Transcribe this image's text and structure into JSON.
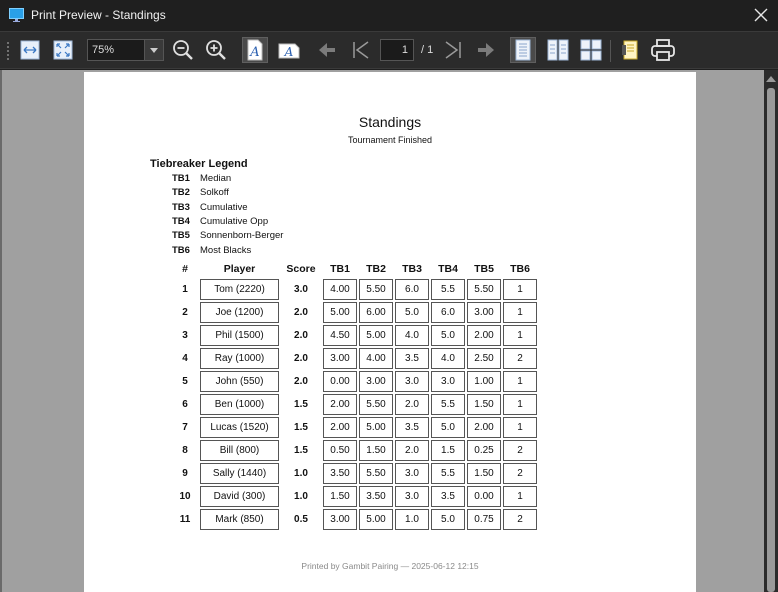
{
  "window": {
    "title": "Print Preview - Standings"
  },
  "toolbar": {
    "zoom_value": "75%",
    "current_page": "1",
    "page_count_label": "/ 1"
  },
  "document": {
    "title": "Standings",
    "subtitle": "Tournament Finished",
    "legend_heading": "Tiebreaker Legend",
    "legend": [
      {
        "code": "TB1",
        "label": "Median"
      },
      {
        "code": "TB2",
        "label": "Solkoff"
      },
      {
        "code": "TB3",
        "label": "Cumulative"
      },
      {
        "code": "TB4",
        "label": "Cumulative Opp"
      },
      {
        "code": "TB5",
        "label": "Sonnenborn-Berger"
      },
      {
        "code": "TB6",
        "label": "Most Blacks"
      }
    ],
    "columns": [
      "#",
      "Player",
      "Score",
      "TB1",
      "TB2",
      "TB3",
      "TB4",
      "TB5",
      "TB6"
    ],
    "rows": [
      [
        "1",
        "Tom (2220)",
        "3.0",
        "4.00",
        "5.50",
        "6.0",
        "5.5",
        "5.50",
        "1"
      ],
      [
        "2",
        "Joe (1200)",
        "2.0",
        "5.00",
        "6.00",
        "5.0",
        "6.0",
        "3.00",
        "1"
      ],
      [
        "3",
        "Phil (1500)",
        "2.0",
        "4.50",
        "5.00",
        "4.0",
        "5.0",
        "2.00",
        "1"
      ],
      [
        "4",
        "Ray (1000)",
        "2.0",
        "3.00",
        "4.00",
        "3.5",
        "4.0",
        "2.50",
        "2"
      ],
      [
        "5",
        "John (550)",
        "2.0",
        "0.00",
        "3.00",
        "3.0",
        "3.0",
        "1.00",
        "1"
      ],
      [
        "6",
        "Ben (1000)",
        "1.5",
        "2.00",
        "5.50",
        "2.0",
        "5.5",
        "1.50",
        "1"
      ],
      [
        "7",
        "Lucas (1520)",
        "1.5",
        "2.00",
        "5.00",
        "3.5",
        "5.0",
        "2.00",
        "1"
      ],
      [
        "8",
        "Bill (800)",
        "1.5",
        "0.50",
        "1.50",
        "2.0",
        "1.5",
        "0.25",
        "2"
      ],
      [
        "9",
        "Sally (1440)",
        "1.0",
        "3.50",
        "5.50",
        "3.0",
        "5.5",
        "1.50",
        "2"
      ],
      [
        "10",
        "David (300)",
        "1.0",
        "1.50",
        "3.50",
        "3.0",
        "3.5",
        "0.00",
        "1"
      ],
      [
        "11",
        "Mark (850)",
        "0.5",
        "3.00",
        "5.00",
        "1.0",
        "5.0",
        "0.75",
        "2"
      ]
    ],
    "footer": "Printed by Gambit Pairing — 2025-06-12 12:15"
  }
}
